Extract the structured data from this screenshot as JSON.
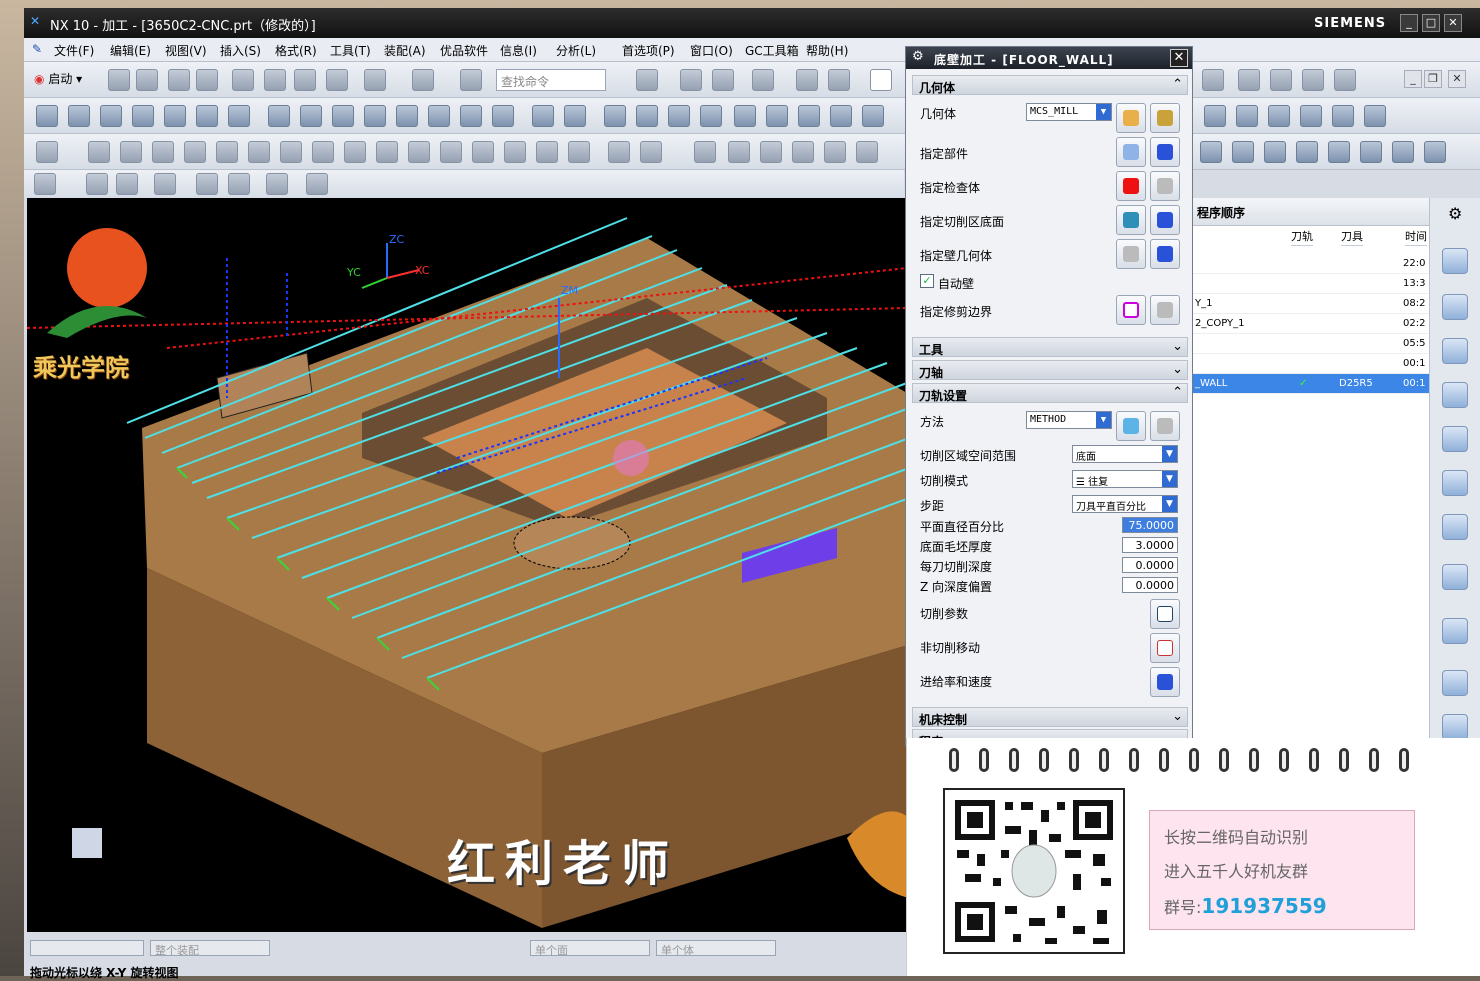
{
  "window": {
    "title": "NX 10 - 加工 - [3650C2-CNC.prt（修改的）]",
    "brand": "SIEMENS"
  },
  "menu": [
    "文件(F)",
    "编辑(E)",
    "视图(V)",
    "插入(S)",
    "格式(R)",
    "工具(T)",
    "装配(A)",
    "优品软件",
    "信息(I)",
    "分析(L)",
    "首选项(P)",
    "窗口(O)",
    "GC工具箱",
    "帮助(H)"
  ],
  "toolbar": {
    "start_label": "启动",
    "search_placeholder": "查找命令"
  },
  "viewport": {
    "watermark": "红利老师",
    "school_logo": "乘光学院",
    "axes": {
      "zc": "ZC",
      "yc": "YC",
      "xc": "XC",
      "zm": "ZM"
    }
  },
  "status_bar": {
    "assembly_filter": "整个装配",
    "face_filter": "单个面",
    "body_filter": "单个体",
    "message": "拖动光标以绕 X-Y 旋转视图"
  },
  "navigator": {
    "header": "程序顺序",
    "columns": [
      "刀轨",
      "刀具",
      "时间"
    ],
    "rows": [
      {
        "name": "",
        "path": "",
        "tool": "",
        "time": "22:0"
      },
      {
        "name": "",
        "path": "",
        "tool": "",
        "time": "13:3"
      },
      {
        "name": "Y_1",
        "path": "",
        "tool": "",
        "time": "08:2"
      },
      {
        "name": "2_COPY_1",
        "path": "",
        "tool": "",
        "time": "02:2"
      },
      {
        "name": "",
        "path": "",
        "tool": "",
        "time": "05:5"
      },
      {
        "name": "",
        "path": "",
        "tool": "",
        "time": "00:1"
      },
      {
        "name": "_WALL",
        "path": "✓",
        "tool": "D25R5",
        "time": "00:1",
        "selected": true
      }
    ]
  },
  "dialog": {
    "title": "底壁加工 - [FLOOR_WALL]",
    "sections": {
      "geometry": "几何体",
      "tool": "工具",
      "tool_axis": "刀轴",
      "path_settings": "刀轨设置",
      "machine_control": "机床控制",
      "program": "程序"
    },
    "geometry": {
      "label": "几何体",
      "value": "MCS_MILL",
      "specify_part": "指定部件",
      "specify_check": "指定检查体",
      "specify_floor": "指定切削区底面",
      "specify_wall": "指定壁几何体",
      "auto_wall": "自动壁",
      "auto_wall_checked": true,
      "specify_trim": "指定修剪边界"
    },
    "path": {
      "method_label": "方法",
      "method_value": "METHOD",
      "cut_region_label": "切削区域空间范围",
      "cut_region_value": "底面",
      "cut_pattern_label": "切削模式",
      "cut_pattern_value": "往复",
      "stepover_label": "步距",
      "stepover_value": "刀具平直百分比",
      "flat_diam_label": "平面直径百分比",
      "flat_diam_value": "75.0000",
      "floor_stock_label": "底面毛坯厚度",
      "floor_stock_value": "3.0000",
      "depth_per_cut_label": "每刀切削深度",
      "depth_per_cut_value": "0.0000",
      "z_offset_label": "Z 向深度偏置",
      "z_offset_value": "0.0000",
      "cut_params": "切削参数",
      "non_cut_moves": "非切削移动",
      "feeds_speeds": "进给率和速度"
    }
  },
  "promo": {
    "line1": "长按二维码自动识别",
    "line2": "进入五千人好机友群",
    "group_label": "群号:",
    "group_number": "191937559"
  },
  "colors": {
    "part": "#a87a47",
    "toolpath": "#4ee0e6",
    "selected_row": "#3c86e8",
    "titlebar": "#1d2229"
  }
}
